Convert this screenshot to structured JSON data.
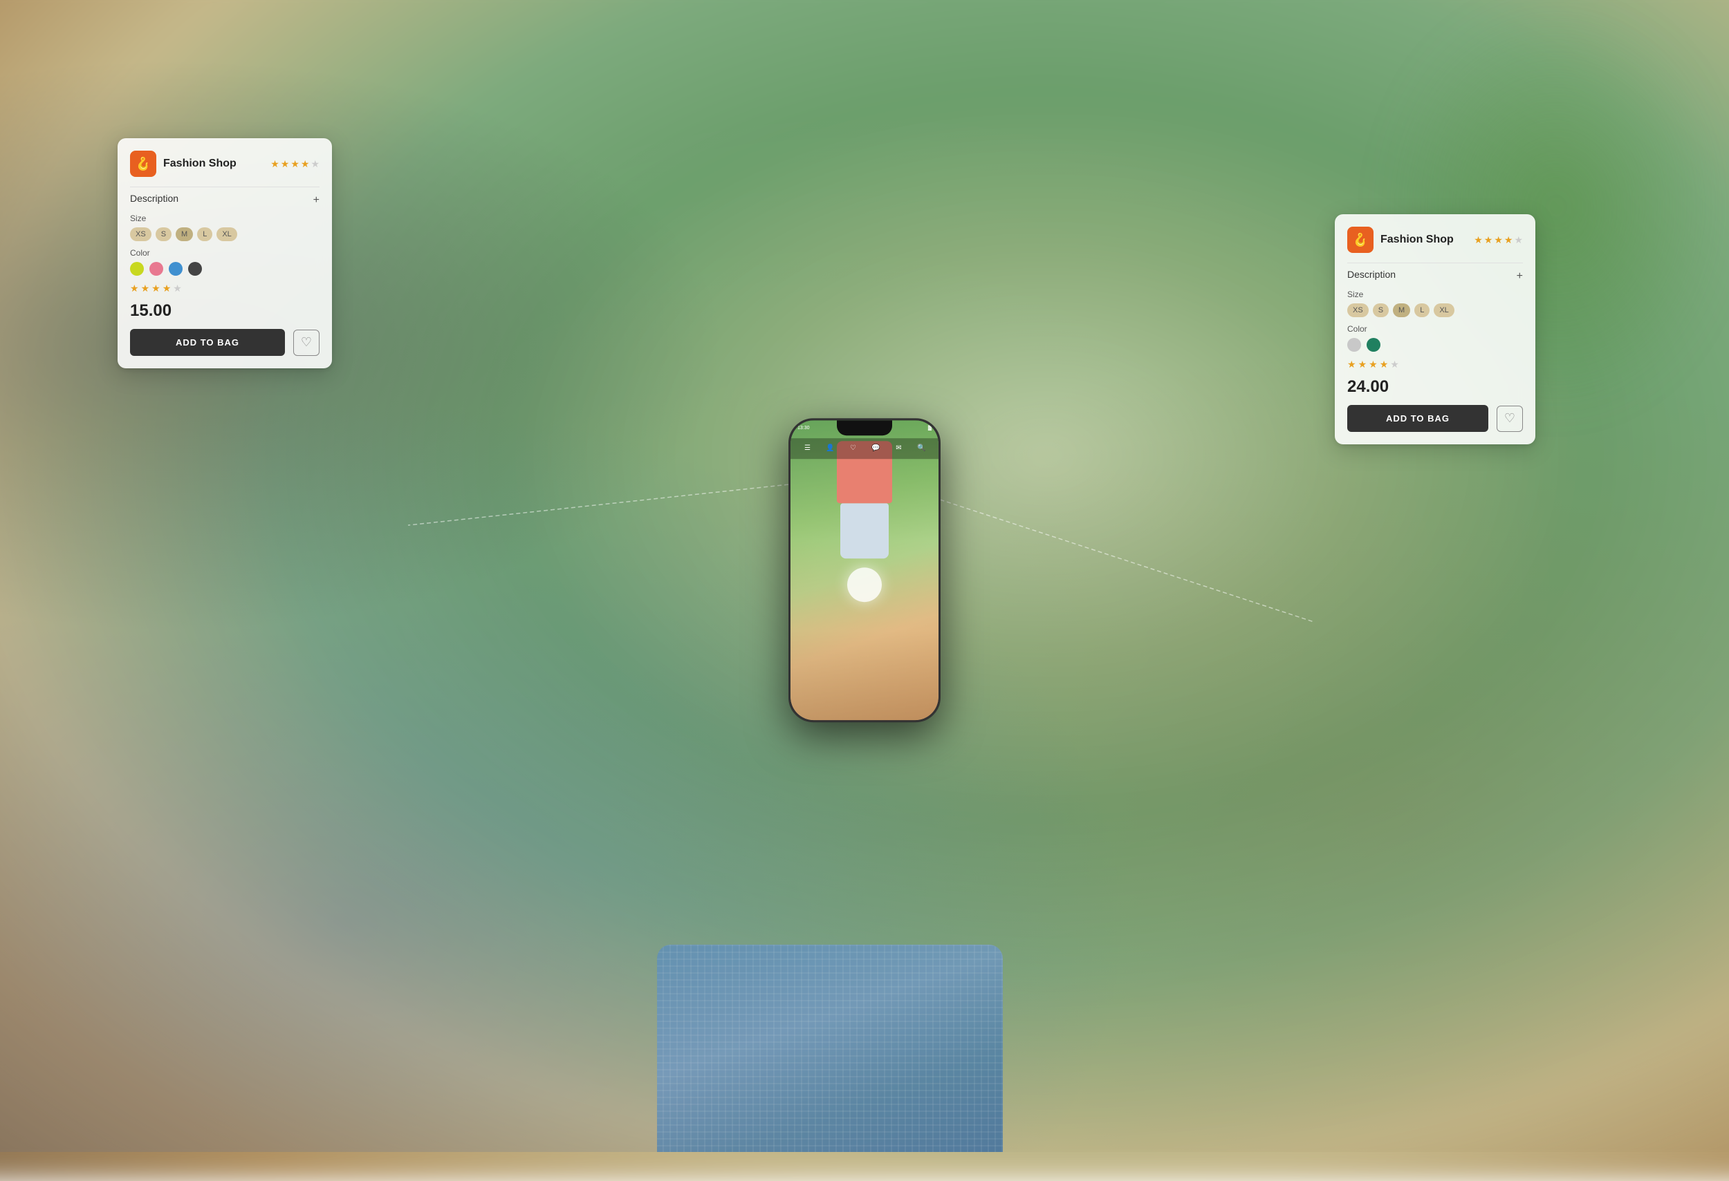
{
  "scene": {
    "background": {
      "description": "Blurred outdoor/retail background with green plants and warm tones"
    }
  },
  "phone": {
    "status_bar": {
      "time": "13:30",
      "signal": "signal",
      "battery": "battery"
    },
    "nav_icons": [
      "menu",
      "user",
      "heart",
      "chat",
      "mail",
      "search"
    ]
  },
  "card_left": {
    "header": {
      "icon": "🪝",
      "title": "Fashion Shop",
      "rating": 4.5,
      "stars_filled": 4,
      "stars_empty": 1
    },
    "description_label": "Description",
    "size_label": "Size",
    "sizes": [
      "XS",
      "S",
      "M",
      "L",
      "XL"
    ],
    "color_label": "Color",
    "colors": [
      "#c8d820",
      "#e87890",
      "#4090d0",
      "#444444"
    ],
    "rating_value": 4.5,
    "price": "15.00",
    "add_to_bag_label": "ADD TO BAG",
    "wishlist_icon": "♡"
  },
  "card_right": {
    "header": {
      "icon": "🪝",
      "title": "Fashion Shop",
      "rating": 4.0,
      "stars_filled": 4,
      "stars_empty": 1
    },
    "description_label": "Description",
    "size_label": "Size",
    "sizes": [
      "XS",
      "S",
      "M",
      "L",
      "XL"
    ],
    "color_label": "Color",
    "colors": [
      "#c8c8c8",
      "#208060"
    ],
    "rating_value": 4.0,
    "price": "24.00",
    "add_to_bag_label": "ADD TO BAG",
    "wishlist_icon": "♡"
  }
}
